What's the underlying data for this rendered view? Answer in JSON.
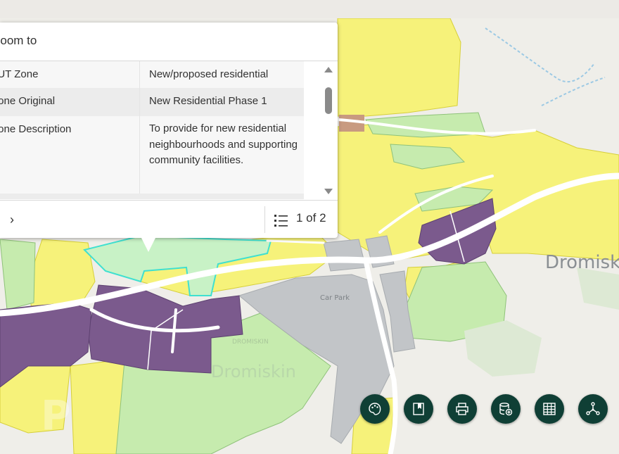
{
  "popup": {
    "header_text": "Zoom to",
    "rows": [
      {
        "field": "LUT Zone",
        "value": "New/proposed residential"
      },
      {
        "field": "Zone Original",
        "value": "New Residential Phase 1"
      },
      {
        "field": "Zone Description",
        "value": "To provide for new residential neighbourhoods and supporting community facilities."
      }
    ],
    "next_glyph": "›",
    "pager": "1 of 2"
  },
  "map_labels": {
    "town_label_east": "Dromisk",
    "town_label_center": "Dromiskin",
    "car_park": "Car Park",
    "small_label": "DROMISKIN",
    "watermark": "P"
  },
  "toolbar": [
    {
      "name": "basemap-gallery-button",
      "icon": "palette-icon"
    },
    {
      "name": "bookmarks-button",
      "icon": "bookmark-icon"
    },
    {
      "name": "print-button",
      "icon": "printer-icon"
    },
    {
      "name": "add-data-button",
      "icon": "database-add-icon"
    },
    {
      "name": "attribute-table-button",
      "icon": "table-icon"
    },
    {
      "name": "share-button",
      "icon": "share-icon"
    }
  ],
  "colors": {
    "residential_yellow": "#f6f27a",
    "new_residential_purple": "#7b5a8d",
    "open_space_green": "#c6ebae",
    "community_grey": "#c2c5c8",
    "road": "#ffffff",
    "selection_cyan": "#3fe0d0",
    "button_dark_green": "#0f3f35"
  }
}
